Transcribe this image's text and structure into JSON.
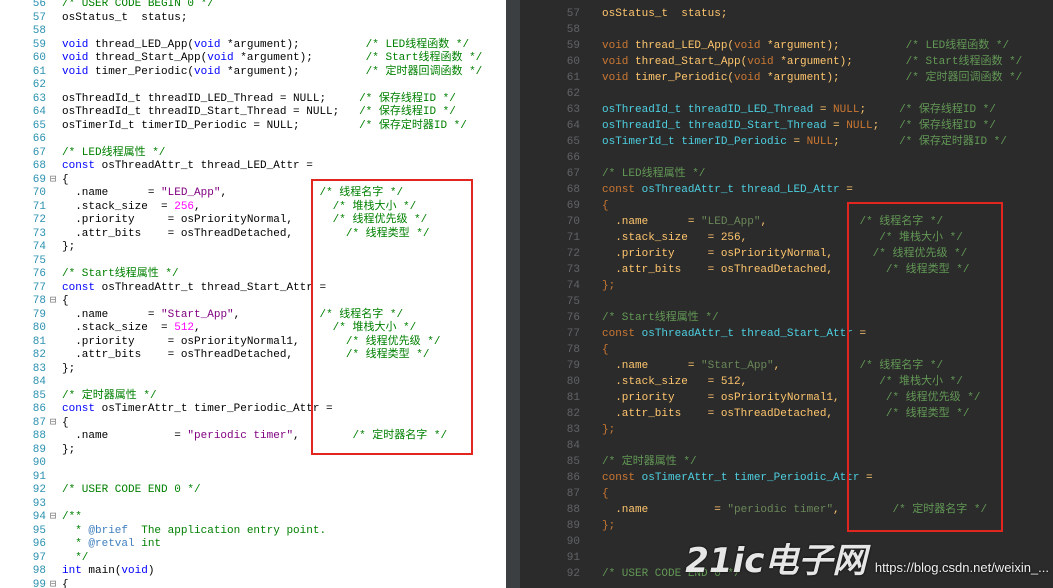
{
  "left_editor": {
    "lines": [
      {
        "n": "56",
        "fold": "",
        "parts": [
          [
            "c",
            "/* USER CODE BEGIN 0 */"
          ]
        ]
      },
      {
        "n": "57",
        "fold": "",
        "parts": [
          [
            "t",
            "osStatus_t  status;"
          ]
        ]
      },
      {
        "n": "58",
        "fold": "",
        "parts": []
      },
      {
        "n": "59",
        "fold": "",
        "parts": [
          [
            "k",
            "void"
          ],
          [
            "t",
            " thread_LED_App("
          ],
          [
            "k",
            "void"
          ],
          [
            "t",
            " *argument);          "
          ],
          [
            "c",
            "/* LED线程函数 */"
          ]
        ]
      },
      {
        "n": "60",
        "fold": "",
        "parts": [
          [
            "k",
            "void"
          ],
          [
            "t",
            " thread_Start_App("
          ],
          [
            "k",
            "void"
          ],
          [
            "t",
            " *argument);        "
          ],
          [
            "c",
            "/* Start线程函数 */"
          ]
        ]
      },
      {
        "n": "61",
        "fold": "",
        "parts": [
          [
            "k",
            "void"
          ],
          [
            "t",
            " timer_Periodic("
          ],
          [
            "k",
            "void"
          ],
          [
            "t",
            " *argument);          "
          ],
          [
            "c",
            "/* 定时器回调函数 */"
          ]
        ]
      },
      {
        "n": "62",
        "fold": "",
        "parts": []
      },
      {
        "n": "63",
        "fold": "",
        "parts": [
          [
            "t",
            "osThreadId_t threadID_LED_Thread = NULL;     "
          ],
          [
            "c",
            "/* 保存线程ID */"
          ]
        ]
      },
      {
        "n": "64",
        "fold": "",
        "parts": [
          [
            "t",
            "osThreadId_t threadID_Start_Thread = NULL;   "
          ],
          [
            "c",
            "/* 保存线程ID */"
          ]
        ]
      },
      {
        "n": "65",
        "fold": "",
        "parts": [
          [
            "t",
            "osTimerId_t timerID_Periodic = NULL;         "
          ],
          [
            "c",
            "/* 保存定时器ID */"
          ]
        ]
      },
      {
        "n": "66",
        "fold": "",
        "parts": []
      },
      {
        "n": "67",
        "fold": "",
        "parts": [
          [
            "c",
            "/* LED线程属性 */"
          ]
        ]
      },
      {
        "n": "68",
        "fold": "",
        "parts": [
          [
            "k",
            "const"
          ],
          [
            "t",
            " osThreadAttr_t thread_LED_Attr ="
          ]
        ]
      },
      {
        "n": "69",
        "fold": "⊟",
        "parts": [
          [
            "t",
            "{"
          ]
        ]
      },
      {
        "n": "70",
        "fold": "",
        "parts": [
          [
            "t",
            "  .name      = "
          ],
          [
            "s",
            "\"LED_App\""
          ],
          [
            "t",
            ",              "
          ],
          [
            "c",
            "/* 线程名字 */"
          ]
        ]
      },
      {
        "n": "71",
        "fold": "",
        "parts": [
          [
            "t",
            "  .stack_size  = "
          ],
          [
            "n",
            "256"
          ],
          [
            "t",
            ",                    "
          ],
          [
            "c",
            "/* 堆栈大小 */"
          ]
        ]
      },
      {
        "n": "72",
        "fold": "",
        "parts": [
          [
            "t",
            "  .priority     = osPriorityNormal,      "
          ],
          [
            "c",
            "/* 线程优先级 */"
          ]
        ]
      },
      {
        "n": "73",
        "fold": "",
        "parts": [
          [
            "t",
            "  .attr_bits    = osThreadDetached,        "
          ],
          [
            "c",
            "/* 线程类型 */"
          ]
        ]
      },
      {
        "n": "74",
        "fold": "",
        "parts": [
          [
            "t",
            "};"
          ]
        ]
      },
      {
        "n": "75",
        "fold": "",
        "parts": []
      },
      {
        "n": "76",
        "fold": "",
        "parts": [
          [
            "c",
            "/* Start线程属性 */"
          ]
        ]
      },
      {
        "n": "77",
        "fold": "",
        "parts": [
          [
            "k",
            "const"
          ],
          [
            "t",
            " osThreadAttr_t thread_Start_Attr ="
          ]
        ]
      },
      {
        "n": "78",
        "fold": "⊟",
        "parts": [
          [
            "t",
            "{"
          ]
        ]
      },
      {
        "n": "79",
        "fold": "",
        "parts": [
          [
            "t",
            "  .name      = "
          ],
          [
            "s",
            "\"Start_App\""
          ],
          [
            "t",
            ",            "
          ],
          [
            "c",
            "/* 线程名字 */"
          ]
        ]
      },
      {
        "n": "80",
        "fold": "",
        "parts": [
          [
            "t",
            "  .stack_size  = "
          ],
          [
            "n",
            "512"
          ],
          [
            "t",
            ",                    "
          ],
          [
            "c",
            "/* 堆栈大小 */"
          ]
        ]
      },
      {
        "n": "81",
        "fold": "",
        "parts": [
          [
            "t",
            "  .priority     = osPriorityNormal1,       "
          ],
          [
            "c",
            "/* 线程优先级 */"
          ]
        ]
      },
      {
        "n": "82",
        "fold": "",
        "parts": [
          [
            "t",
            "  .attr_bits    = osThreadDetached,        "
          ],
          [
            "c",
            "/* 线程类型 */"
          ]
        ]
      },
      {
        "n": "83",
        "fold": "",
        "parts": [
          [
            "t",
            "};"
          ]
        ]
      },
      {
        "n": "84",
        "fold": "",
        "parts": []
      },
      {
        "n": "85",
        "fold": "",
        "parts": [
          [
            "c",
            "/* 定时器属性 */"
          ]
        ]
      },
      {
        "n": "86",
        "fold": "",
        "parts": [
          [
            "k",
            "const"
          ],
          [
            "t",
            " osTimerAttr_t timer_Periodic_Attr ="
          ]
        ]
      },
      {
        "n": "87",
        "fold": "⊟",
        "parts": [
          [
            "t",
            "{"
          ]
        ]
      },
      {
        "n": "88",
        "fold": "",
        "parts": [
          [
            "t",
            "  .name          = "
          ],
          [
            "s",
            "\"periodic timer\""
          ],
          [
            "t",
            ",        "
          ],
          [
            "c",
            "/* 定时器名字 */"
          ]
        ]
      },
      {
        "n": "89",
        "fold": "",
        "parts": [
          [
            "t",
            "};"
          ]
        ]
      },
      {
        "n": "90",
        "fold": "",
        "parts": []
      },
      {
        "n": "91",
        "fold": "",
        "parts": []
      },
      {
        "n": "92",
        "fold": "",
        "parts": [
          [
            "c",
            "/* USER CODE END 0 */"
          ]
        ]
      },
      {
        "n": "93",
        "fold": "",
        "parts": []
      },
      {
        "n": "94",
        "fold": "⊟",
        "parts": [
          [
            "c",
            "/**"
          ]
        ]
      },
      {
        "n": "95",
        "fold": "",
        "parts": [
          [
            "c",
            "  * "
          ],
          [
            "d",
            "@brief"
          ],
          [
            "c",
            "  The application entry point."
          ]
        ]
      },
      {
        "n": "96",
        "fold": "",
        "parts": [
          [
            "c",
            "  * "
          ],
          [
            "d",
            "@retval"
          ],
          [
            "c",
            " int"
          ]
        ]
      },
      {
        "n": "97",
        "fold": "",
        "parts": [
          [
            "c",
            "  */"
          ]
        ]
      },
      {
        "n": "98",
        "fold": "",
        "parts": [
          [
            "k",
            "int"
          ],
          [
            "t",
            " main("
          ],
          [
            "k",
            "void"
          ],
          [
            "t",
            ")"
          ]
        ]
      },
      {
        "n": "99",
        "fold": "⊟",
        "parts": [
          [
            "t",
            "{"
          ]
        ]
      }
    ]
  },
  "right_editor": {
    "lines": [
      {
        "n": "56",
        "fold": "",
        "parts": [
          [
            "c",
            "/* USER CODE BEGIN 0 */"
          ]
        ]
      },
      {
        "n": "57",
        "fold": "",
        "parts": [
          [
            "t",
            "osStatus_t  status;"
          ]
        ]
      },
      {
        "n": "58",
        "fold": "",
        "parts": []
      },
      {
        "n": "59",
        "fold": "",
        "parts": [
          [
            "k",
            "void"
          ],
          [
            "t",
            " thread_LED_App("
          ],
          [
            "k",
            "void"
          ],
          [
            "t",
            " *argument);          "
          ],
          [
            "c",
            "/* LED线程函数 */"
          ]
        ]
      },
      {
        "n": "60",
        "fold": "",
        "parts": [
          [
            "k",
            "void"
          ],
          [
            "t",
            " thread_Start_App("
          ],
          [
            "k",
            "void"
          ],
          [
            "t",
            " *argument);        "
          ],
          [
            "c",
            "/* Start线程函数 */"
          ]
        ]
      },
      {
        "n": "61",
        "fold": "",
        "parts": [
          [
            "k",
            "void"
          ],
          [
            "t",
            " timer_Periodic("
          ],
          [
            "k",
            "void"
          ],
          [
            "t",
            " *argument);          "
          ],
          [
            "c",
            "/* 定时器回调函数 */"
          ]
        ]
      },
      {
        "n": "62",
        "fold": "",
        "parts": []
      },
      {
        "n": "63",
        "fold": "",
        "parts": [
          [
            "v",
            "osThreadId_t threadID_LED_Thread"
          ],
          [
            "t",
            " = "
          ],
          [
            "k",
            "NULL"
          ],
          [
            "t",
            ";     "
          ],
          [
            "c",
            "/* 保存线程ID */"
          ]
        ]
      },
      {
        "n": "64",
        "fold": "",
        "parts": [
          [
            "v",
            "osThreadId_t threadID_Start_Thread"
          ],
          [
            "t",
            " = "
          ],
          [
            "k",
            "NULL"
          ],
          [
            "t",
            ";   "
          ],
          [
            "c",
            "/* 保存线程ID */"
          ]
        ]
      },
      {
        "n": "65",
        "fold": "",
        "parts": [
          [
            "v",
            "osTimerId_t timerID_Periodic"
          ],
          [
            "t",
            " = "
          ],
          [
            "k",
            "NULL"
          ],
          [
            "t",
            ";         "
          ],
          [
            "c",
            "/* 保存定时器ID */"
          ]
        ]
      },
      {
        "n": "66",
        "fold": "",
        "parts": []
      },
      {
        "n": "67",
        "fold": "",
        "parts": [
          [
            "c",
            "/* LED线程属性 */"
          ]
        ]
      },
      {
        "n": "68",
        "fold": "",
        "parts": [
          [
            "k",
            "const"
          ],
          [
            "v",
            " osThreadAttr_t thread_LED_Attr"
          ],
          [
            "t",
            " ="
          ]
        ]
      },
      {
        "n": "69",
        "fold": "",
        "parts": [
          [
            "k",
            "{"
          ]
        ]
      },
      {
        "n": "70",
        "fold": "",
        "parts": [
          [
            "t",
            "  .name      = "
          ],
          [
            "s",
            "\"LED_App\""
          ],
          [
            "t",
            ",              "
          ],
          [
            "c",
            "/* 线程名字 */"
          ]
        ]
      },
      {
        "n": "71",
        "fold": "",
        "parts": [
          [
            "t",
            "  .stack_size   = 256,                    "
          ],
          [
            "c",
            "/* 堆栈大小 */"
          ]
        ]
      },
      {
        "n": "72",
        "fold": "",
        "parts": [
          [
            "t",
            "  .priority     = osPriorityNormal,      "
          ],
          [
            "c",
            "/* 线程优先级 */"
          ]
        ]
      },
      {
        "n": "73",
        "fold": "",
        "parts": [
          [
            "t",
            "  .attr_bits    = osThreadDetached,        "
          ],
          [
            "c",
            "/* 线程类型 */"
          ]
        ]
      },
      {
        "n": "74",
        "fold": "",
        "parts": [
          [
            "k",
            "};"
          ]
        ]
      },
      {
        "n": "75",
        "fold": "",
        "parts": []
      },
      {
        "n": "76",
        "fold": "",
        "parts": [
          [
            "c",
            "/* Start线程属性 */"
          ]
        ]
      },
      {
        "n": "77",
        "fold": "",
        "parts": [
          [
            "k",
            "const"
          ],
          [
            "v",
            " osThreadAttr_t thread_Start_Attr"
          ],
          [
            "t",
            " ="
          ]
        ]
      },
      {
        "n": "78",
        "fold": "",
        "parts": [
          [
            "k",
            "{"
          ]
        ]
      },
      {
        "n": "79",
        "fold": "",
        "parts": [
          [
            "t",
            "  .name      = "
          ],
          [
            "s",
            "\"Start_App\""
          ],
          [
            "t",
            ",            "
          ],
          [
            "c",
            "/* 线程名字 */"
          ]
        ]
      },
      {
        "n": "80",
        "fold": "",
        "parts": [
          [
            "t",
            "  .stack_size   = 512,                    "
          ],
          [
            "c",
            "/* 堆栈大小 */"
          ]
        ]
      },
      {
        "n": "81",
        "fold": "",
        "parts": [
          [
            "t",
            "  .priority     = osPriorityNormal1,       "
          ],
          [
            "c",
            "/* 线程优先级 */"
          ]
        ]
      },
      {
        "n": "82",
        "fold": "",
        "parts": [
          [
            "t",
            "  .attr_bits    = osThreadDetached,        "
          ],
          [
            "c",
            "/* 线程类型 */"
          ]
        ]
      },
      {
        "n": "83",
        "fold": "",
        "parts": [
          [
            "k",
            "};"
          ]
        ]
      },
      {
        "n": "84",
        "fold": "",
        "parts": []
      },
      {
        "n": "85",
        "fold": "",
        "parts": [
          [
            "c",
            "/* 定时器属性 */"
          ]
        ]
      },
      {
        "n": "86",
        "fold": "",
        "parts": [
          [
            "k",
            "const"
          ],
          [
            "v",
            " osTimerAttr_t timer_Periodic_Attr"
          ],
          [
            "t",
            " ="
          ]
        ]
      },
      {
        "n": "87",
        "fold": "",
        "parts": [
          [
            "k",
            "{"
          ]
        ]
      },
      {
        "n": "88",
        "fold": "",
        "parts": [
          [
            "t",
            "  .name          = "
          ],
          [
            "s",
            "\"periodic timer\""
          ],
          [
            "t",
            ",        "
          ],
          [
            "c",
            "/* 定时器名字 */"
          ]
        ]
      },
      {
        "n": "89",
        "fold": "",
        "parts": [
          [
            "k",
            "};"
          ]
        ]
      },
      {
        "n": "90",
        "fold": "",
        "parts": []
      },
      {
        "n": "91",
        "fold": "",
        "parts": []
      },
      {
        "n": "92",
        "fold": "",
        "parts": [
          [
            "c",
            "/* USER CODE END 0 */"
          ]
        ]
      }
    ]
  },
  "watermark": {
    "logo": "21ic电子网",
    "url": "https://blog.csdn.net/weixin_..."
  },
  "colors": {
    "highlight_box": "#e0261e",
    "left_background": "#ffffff",
    "right_background": "#2b2b2b"
  }
}
